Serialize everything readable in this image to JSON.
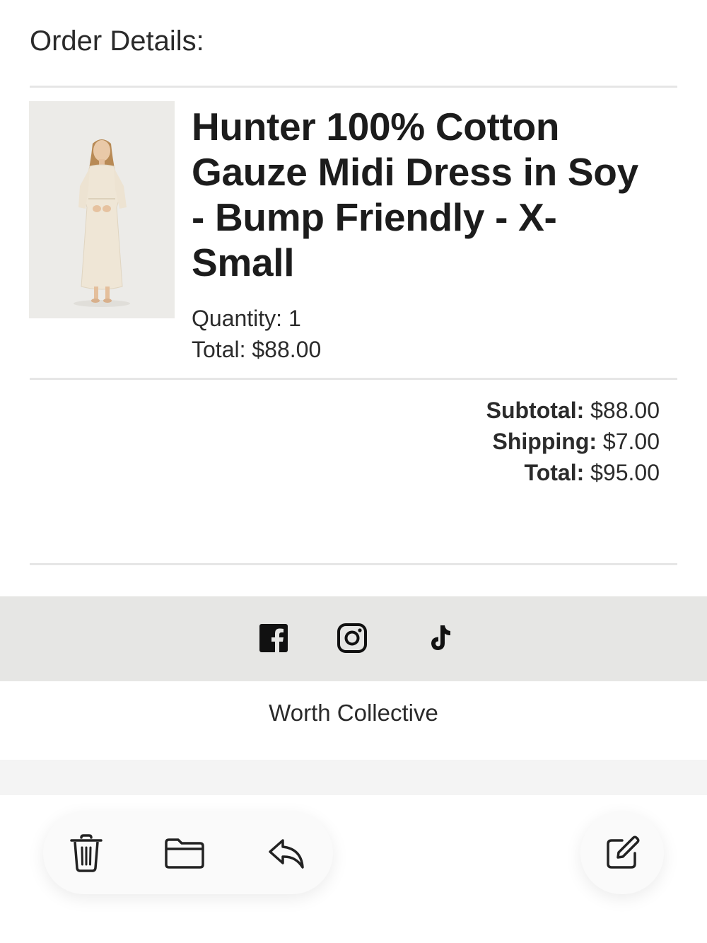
{
  "order": {
    "section_title": "Order Details:",
    "product": {
      "title": "Hunter 100% Cotton Gauze Midi Dress in Soy - Bump Friendly - X-Small",
      "quantity_text": "Quantity: 1",
      "total_text": "Total: $88.00"
    },
    "summary": {
      "subtotal_label": "Subtotal:",
      "subtotal_value": "$88.00",
      "shipping_label": "Shipping:",
      "shipping_value": "$7.00",
      "total_label": "Total:",
      "total_value": "$95.00"
    }
  },
  "footer": {
    "social_icons": [
      "facebook-icon",
      "instagram-icon",
      "tiktok-icon"
    ],
    "store_name": "Worth Collective"
  },
  "toolbar": {
    "icons": [
      "trash-icon",
      "folder-icon",
      "reply-icon",
      "compose-icon"
    ]
  }
}
